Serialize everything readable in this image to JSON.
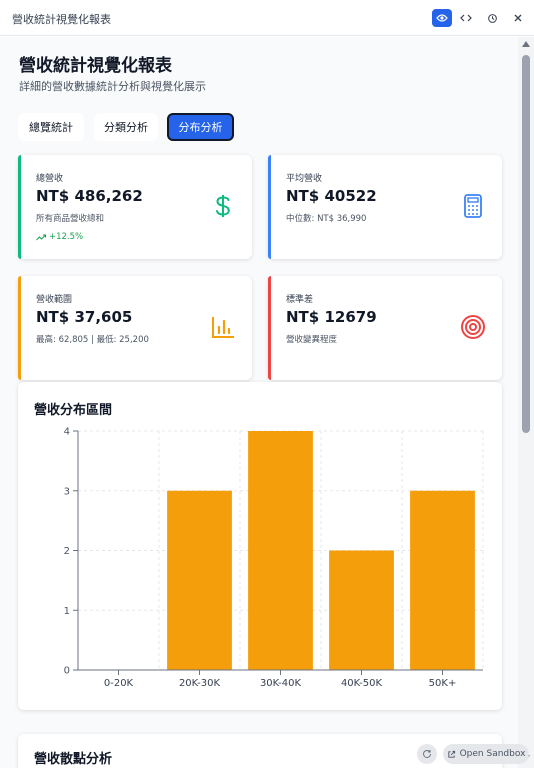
{
  "window": {
    "title": "營收統計視覺化報表"
  },
  "header": {
    "title": "營收統計視覺化報表",
    "subtitle": "詳細的營收數據統計分析與視覺化展示"
  },
  "tabs": [
    {
      "label": "總覽統計",
      "active": false
    },
    {
      "label": "分類分析",
      "active": false
    },
    {
      "label": "分布分析",
      "active": true
    }
  ],
  "cards": [
    {
      "label": "總營收",
      "value": "NT$ 486,262",
      "note": "所有商品營收總和",
      "trend": "+12.5%",
      "icon": "dollar-icon",
      "accent": "#10b981"
    },
    {
      "label": "平均營收",
      "value": "NT$ 40522",
      "note": "中位數: NT$ 36,990",
      "icon": "calculator-icon",
      "accent": "#3b82f6"
    },
    {
      "label": "營收範圍",
      "value": "NT$ 37,605",
      "note": "最高: 62,805 | 最低: 25,200",
      "icon": "bar-chart-icon",
      "accent": "#f59e0b"
    },
    {
      "label": "標準差",
      "value": "NT$ 12679",
      "note": "營收變異程度",
      "icon": "target-icon",
      "accent": "#ef4444"
    }
  ],
  "chart_data": {
    "type": "bar",
    "title": "營收分布區間",
    "categories": [
      "0-20K",
      "20K-30K",
      "30K-40K",
      "40K-50K",
      "50K+"
    ],
    "values": [
      0,
      3,
      4,
      2,
      3
    ],
    "ylim": [
      0,
      4
    ],
    "yticks": [
      "0",
      "1",
      "2",
      "3",
      "4"
    ],
    "grid": true,
    "bar_color": "#f59e0b"
  },
  "section2": {
    "title": "營收散點分析"
  },
  "sandbox": {
    "label": "Open Sandbox"
  }
}
